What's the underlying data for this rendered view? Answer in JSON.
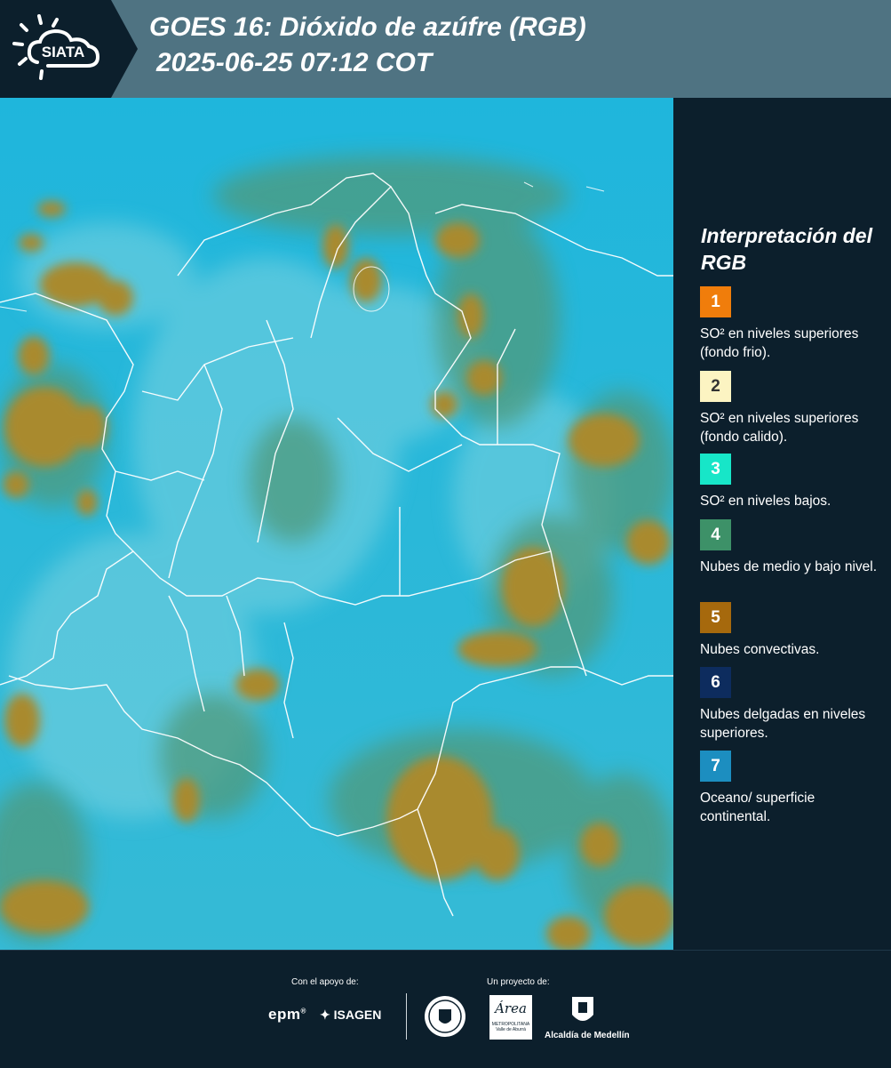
{
  "header": {
    "logo_text": "SIATA",
    "title_line1": "GOES 16: Dióxido de azúfre (RGB)",
    "title_line2": "2025-06-25 07:12 COT"
  },
  "map": {
    "background_color": "#2bb6d8",
    "cloud_color": "#a98a2e",
    "boundary_color": "#ffffff"
  },
  "legend": {
    "title": "Interpretación del RGB",
    "items": [
      {
        "number": "1",
        "color": "#f07d0b",
        "label": "SO² en niveles superiores (fondo frio)."
      },
      {
        "number": "2",
        "color": "#fcf4c2",
        "label": "SO² en niveles superiores (fondo calido)."
      },
      {
        "number": "3",
        "color": "#17e6c8",
        "label": "SO² en niveles bajos."
      },
      {
        "number": "4",
        "color": "#3d9168",
        "label": "Nubes de medio y bajo nivel."
      },
      {
        "number": "5",
        "color": "#a6690d",
        "label": "Nubes convectivas."
      },
      {
        "number": "6",
        "color": "#0d2c5e",
        "label": "Nubes delgadas en niveles superiores."
      },
      {
        "number": "7",
        "color": "#1c8ec0",
        "label": "Oceano/ superficie continental."
      }
    ]
  },
  "footer": {
    "support_label": "Con el apoyo de:",
    "project_label": "Un proyecto de:",
    "epm_text": "epm",
    "isagen_text": "ISAGEN",
    "area_text": "Área",
    "area_sub": "METROPOLITANA Valle de Aburrá",
    "alcaldia_text": "Alcaldía de Medellín"
  }
}
